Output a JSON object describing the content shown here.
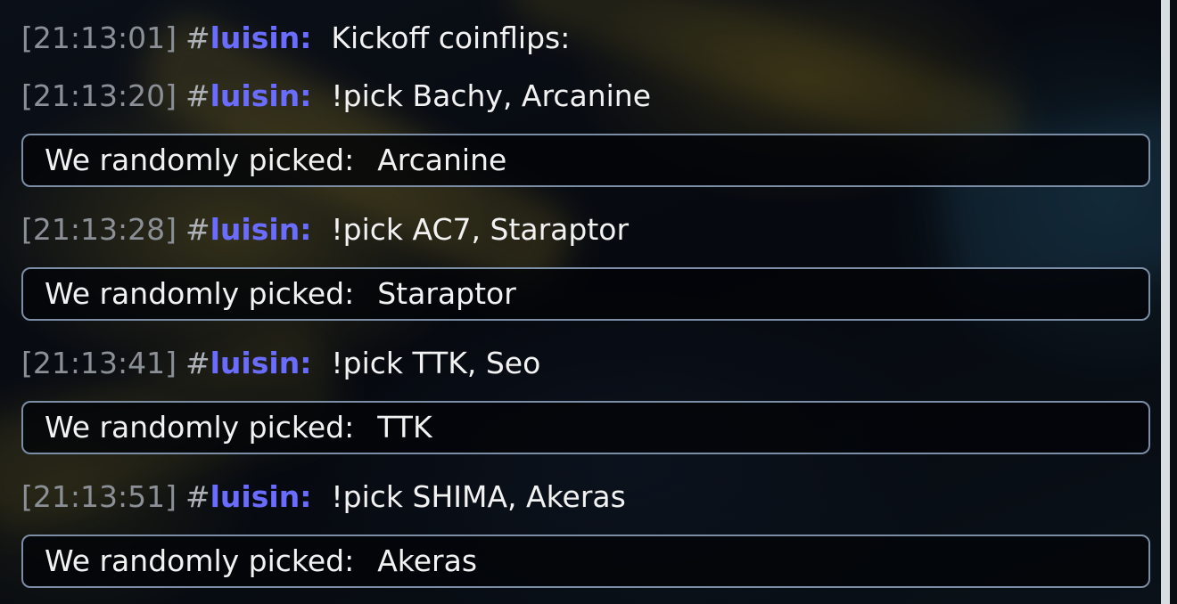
{
  "chat": {
    "lines": [
      {
        "timestamp": "[21:13:01]",
        "hash": "#",
        "user": "luisin",
        "sep": ":",
        "message": "Kickoff coinflips:"
      },
      {
        "timestamp": "[21:13:20]",
        "hash": "#",
        "user": "luisin",
        "sep": ":",
        "message": "!pick Bachy, Arcanine"
      },
      {
        "timestamp": "[21:13:28]",
        "hash": "#",
        "user": "luisin",
        "sep": ":",
        "message": "!pick AC7, Staraptor"
      },
      {
        "timestamp": "[21:13:41]",
        "hash": "#",
        "user": "luisin",
        "sep": ":",
        "message": "!pick TTK, Seo"
      },
      {
        "timestamp": "[21:13:51]",
        "hash": "#",
        "user": "luisin",
        "sep": ":",
        "message": "!pick SHIMA, Akeras"
      }
    ],
    "results": [
      {
        "label": "We randomly picked:",
        "value": "Arcanine"
      },
      {
        "label": "We randomly picked:",
        "value": "Staraptor"
      },
      {
        "label": "We randomly picked:",
        "value": "TTK"
      },
      {
        "label": "We randomly picked:",
        "value": "Akeras"
      }
    ]
  },
  "colors": {
    "username": "#6a6cff",
    "timestamp": "#8b8f96",
    "message": "#f2f2f2",
    "result_border": "#7c8da6"
  }
}
